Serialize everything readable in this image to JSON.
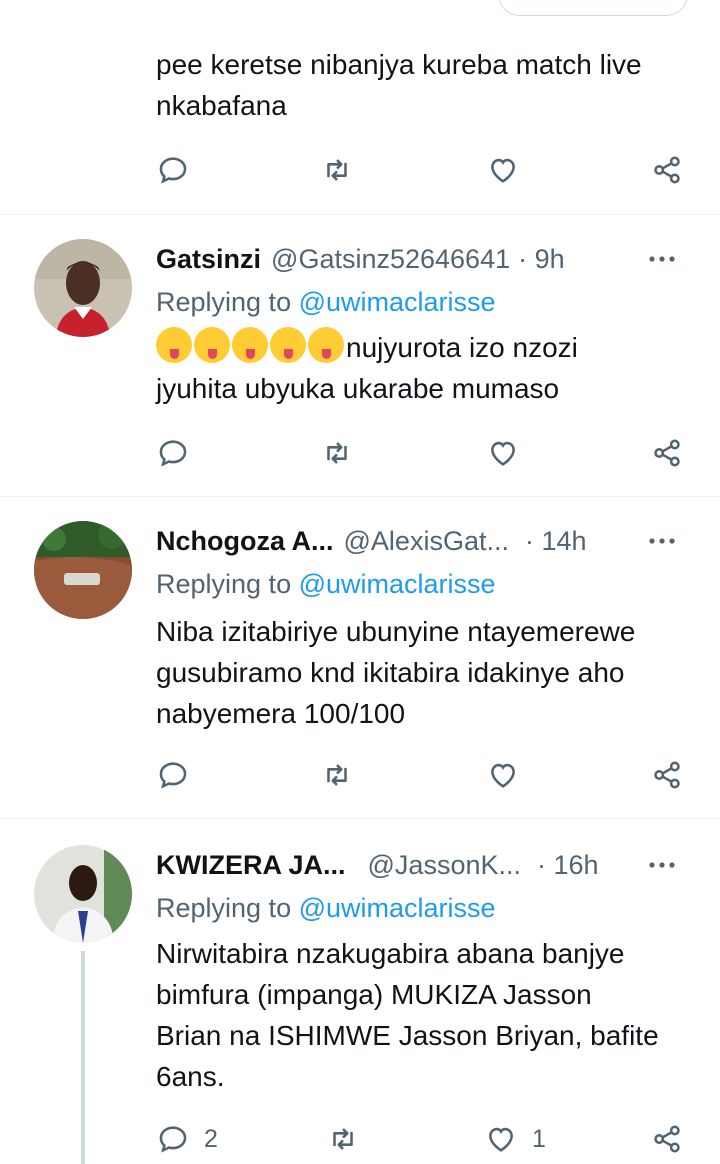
{
  "top_tweet": {
    "text_lines": [
      "pee keretse nibanjya kureba match live",
      "nkabafana"
    ]
  },
  "tweets": [
    {
      "name": "Gatsinzi",
      "handle": "@Gatsinz52646641",
      "time": "· 9h",
      "replying_prefix": "Replying to",
      "mention": "@uwimaclarisse",
      "emoji_count": 5,
      "text_after_emoji": "nujyurota izo nzozi",
      "text_lines": [
        "jyuhita ubyuka ukarabe mumaso"
      ],
      "reply_count": "",
      "like_count": ""
    },
    {
      "name": "Nchogoza A...",
      "handle": "@AlexisGat...",
      "time": "· 14h",
      "replying_prefix": "Replying to",
      "mention": "@uwimaclarisse",
      "text_lines": [
        "Niba izitabiriye ubunyine ntayemerewe",
        "gusubiramo knd ikitabira idakinye aho",
        "nabyemera 100/100"
      ],
      "reply_count": "",
      "like_count": ""
    },
    {
      "name": "KWIZERA JA...",
      "handle": "@JassonK...",
      "time": "· 16h",
      "replying_prefix": "Replying to",
      "mention": "@uwimaclarisse",
      "text_lines": [
        "Nirwitabira nzakugabira abana banjye",
        "bimfura (impanga) MUKIZA Jasson",
        "Brian na ISHIMWE Jasson Briyan, bafite",
        "6ans."
      ],
      "reply_count": "2",
      "like_count": "1"
    }
  ],
  "icons": {
    "reply": "reply-icon",
    "retweet": "retweet-icon",
    "like": "like-icon",
    "share": "share-icon",
    "more": "more-icon"
  },
  "colors": {
    "link": "#1d9bf0",
    "secondary": "#536471",
    "text": "#0f1419"
  }
}
